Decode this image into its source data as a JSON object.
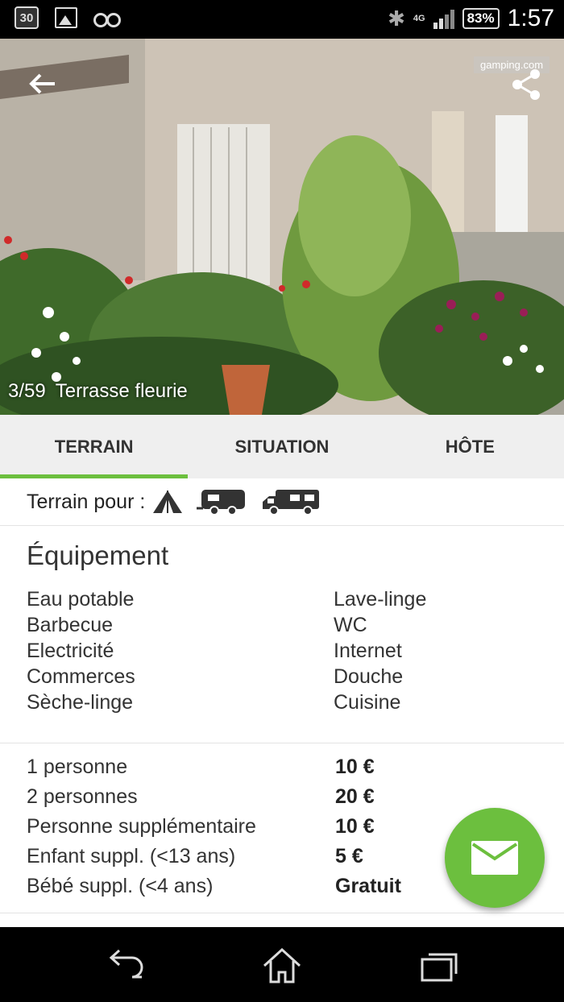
{
  "status_bar": {
    "calendar_day": "30",
    "network": "4G",
    "battery": "83%",
    "time": "1:57",
    "icons": [
      "calendar-icon",
      "gallery-icon",
      "glasses-icon",
      "bluetooth-icon",
      "signal-icon",
      "battery-icon"
    ]
  },
  "hero": {
    "watermark": "gamping.com",
    "photo_index": "3/59",
    "caption": "Terrasse fleurie",
    "back_icon": "back-arrow-icon",
    "share_icon": "share-icon"
  },
  "tabs": [
    {
      "label": "TERRAIN",
      "active": true
    },
    {
      "label": "SITUATION",
      "active": false
    },
    {
      "label": "HÔTE",
      "active": false
    }
  ],
  "terrain": {
    "label": "Terrain pour :",
    "types": [
      "tent-icon",
      "caravan-icon",
      "camper-van-icon"
    ]
  },
  "equipment": {
    "title": "Équipement",
    "left": [
      "Eau potable",
      "Barbecue",
      "Electricité",
      "Commerces",
      "Sèche-linge"
    ],
    "right": [
      "Lave-linge",
      "WC",
      "Internet",
      "Douche",
      "Cuisine"
    ]
  },
  "prices": [
    {
      "label": "1 personne",
      "value": "10 €"
    },
    {
      "label": "2 personnes",
      "value": "20 €"
    },
    {
      "label": "Personne supplémentaire",
      "value": "10 €"
    },
    {
      "label": "Enfant suppl. (<13 ans)",
      "value": "5 €"
    },
    {
      "label": "Bébé suppl. (<4 ans)",
      "value": "Gratuit"
    }
  ],
  "fab": {
    "icon": "mail-icon"
  },
  "colors": {
    "accent": "#6cbf3e",
    "tab_bg": "#efefef",
    "divider": "#e3e3e3"
  },
  "nav": {
    "icons": [
      "back-icon",
      "home-icon",
      "recents-icon"
    ]
  }
}
